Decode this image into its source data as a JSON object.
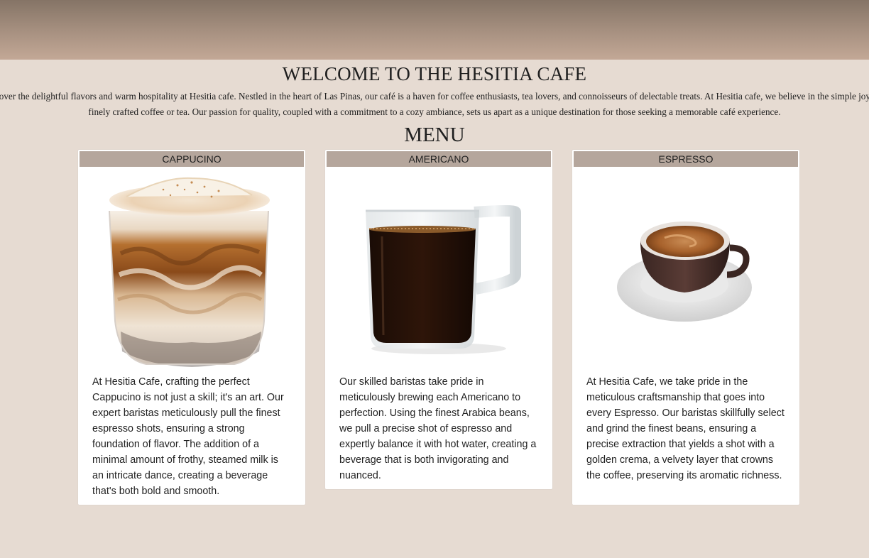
{
  "header": {
    "title": "WELCOME TO THE HESITIA CAFE"
  },
  "intro": {
    "text": "Discover the delightful flavors and warm hospitality at Hesitia cafe. Nestled in the heart of Las Pinas, our café is a haven for coffee enthusiasts, tea lovers, and connoisseurs of delectable treats. At Hesitia cafe, we believe in the simple joy of a finely crafted coffee or tea. Our passion for quality, coupled with a commitment to a cozy ambiance, sets us apart as a unique destination for those seeking a memorable café experience."
  },
  "menu": {
    "title": "MENU",
    "items": [
      {
        "name": "CAPPUCINO",
        "image_icon": "cappuccino-glass-image",
        "description": "At Hesitia Cafe, crafting the perfect Cappucino is not just a skill; it's an art. Our expert baristas meticulously pull the finest espresso shots, ensuring a strong foundation of flavor. The addition of a minimal amount of frothy, steamed milk is an intricate dance, creating a beverage that's both bold and smooth."
      },
      {
        "name": "AMERICANO",
        "image_icon": "americano-mug-image",
        "description": "Our skilled baristas take pride in meticulously brewing each Americano to perfection. Using the finest Arabica beans, we pull a precise shot of espresso and expertly balance it with hot water, creating a beverage that is both invigorating and nuanced."
      },
      {
        "name": "ESPRESSO",
        "image_icon": "espresso-cup-image",
        "description": "At Hesitia Cafe, we take pride in the meticulous craftsmanship that goes into every Espresso. Our baristas skillfully select and grind the finest beans, ensuring a precise extraction that yields a shot with a golden crema, a velvety layer that crowns the coffee, preserving its aromatic richness."
      }
    ]
  },
  "colors": {
    "background": "#e6dbd2",
    "card_header": "#b5a69c",
    "banner_top": "#857466",
    "banner_bottom": "#c3a896"
  }
}
